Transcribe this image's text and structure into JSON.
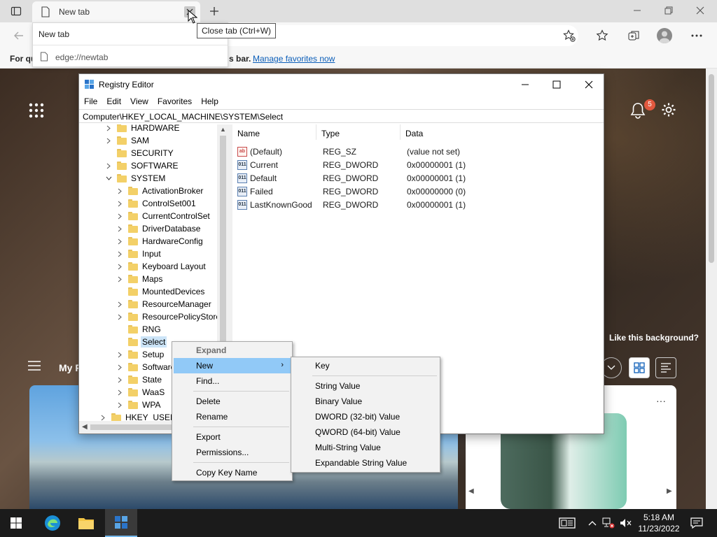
{
  "browser": {
    "tab_title": "New tab",
    "tooltip": "Close tab (Ctrl+W)",
    "dropdown": {
      "title": "New tab",
      "url": "edge://newtab"
    },
    "favbar": {
      "text": "For qu",
      "text_tail": "s bar.",
      "link": "Manage favorites now"
    },
    "ntp": {
      "like_background": "Like this background?",
      "my_feed": "My F",
      "notification_count": "5"
    }
  },
  "regedit": {
    "title": "Registry Editor",
    "menu": [
      "File",
      "Edit",
      "View",
      "Favorites",
      "Help"
    ],
    "path": "Computer\\HKEY_LOCAL_MACHINE\\SYSTEM\\Select",
    "tree": [
      {
        "label": "HARDWARE",
        "level": 1,
        "chev": "right"
      },
      {
        "label": "SAM",
        "level": 1,
        "chev": "right"
      },
      {
        "label": "SECURITY",
        "level": 1,
        "chev": "none"
      },
      {
        "label": "SOFTWARE",
        "level": 1,
        "chev": "right"
      },
      {
        "label": "SYSTEM",
        "level": 1,
        "chev": "down"
      },
      {
        "label": "ActivationBroker",
        "level": 2,
        "chev": "right"
      },
      {
        "label": "ControlSet001",
        "level": 2,
        "chev": "right"
      },
      {
        "label": "CurrentControlSet",
        "level": 2,
        "chev": "right"
      },
      {
        "label": "DriverDatabase",
        "level": 2,
        "chev": "right"
      },
      {
        "label": "HardwareConfig",
        "level": 2,
        "chev": "right"
      },
      {
        "label": "Input",
        "level": 2,
        "chev": "right"
      },
      {
        "label": "Keyboard Layout",
        "level": 2,
        "chev": "right"
      },
      {
        "label": "Maps",
        "level": 2,
        "chev": "right"
      },
      {
        "label": "MountedDevices",
        "level": 2,
        "chev": "none"
      },
      {
        "label": "ResourceManager",
        "level": 2,
        "chev": "right"
      },
      {
        "label": "ResourcePolicyStore",
        "level": 2,
        "chev": "right"
      },
      {
        "label": "RNG",
        "level": 2,
        "chev": "none"
      },
      {
        "label": "Select",
        "level": 2,
        "chev": "none",
        "selected": true
      },
      {
        "label": "Setup",
        "level": 2,
        "chev": "right"
      },
      {
        "label": "Software",
        "level": 2,
        "chev": "right"
      },
      {
        "label": "State",
        "level": 2,
        "chev": "right"
      },
      {
        "label": "WaaS",
        "level": 2,
        "chev": "right"
      },
      {
        "label": "WPA",
        "level": 2,
        "chev": "right"
      },
      {
        "label": "HKEY_USERS",
        "level": 0,
        "chev": "right"
      }
    ],
    "columns": [
      "Name",
      "Type",
      "Data"
    ],
    "values": [
      {
        "name": "(Default)",
        "type": "REG_SZ",
        "data": "(value not set)",
        "icon": "ab"
      },
      {
        "name": "Current",
        "type": "REG_DWORD",
        "data": "0x00000001 (1)",
        "icon": "011"
      },
      {
        "name": "Default",
        "type": "REG_DWORD",
        "data": "0x00000001 (1)",
        "icon": "011"
      },
      {
        "name": "Failed",
        "type": "REG_DWORD",
        "data": "0x00000000 (0)",
        "icon": "011"
      },
      {
        "name": "LastKnownGood",
        "type": "REG_DWORD",
        "data": "0x00000001 (1)",
        "icon": "011"
      }
    ]
  },
  "context_menu": {
    "expand": "Expand",
    "new": "New",
    "find": "Find...",
    "delete": "Delete",
    "rename": "Rename",
    "export": "Export",
    "permissions": "Permissions...",
    "copy_key_name": "Copy Key Name"
  },
  "new_submenu": {
    "key": "Key",
    "string": "String Value",
    "binary": "Binary Value",
    "dword": "DWORD (32-bit) Value",
    "qword": "QWORD (64-bit) Value",
    "multi": "Multi-String Value",
    "expandable": "Expandable String Value"
  },
  "taskbar": {
    "time": "5:18 AM",
    "date": "11/23/2022"
  },
  "colors": {
    "accent": "#0078d4",
    "selection": "#cce4f7",
    "menu_highlight": "#91c9f7"
  }
}
